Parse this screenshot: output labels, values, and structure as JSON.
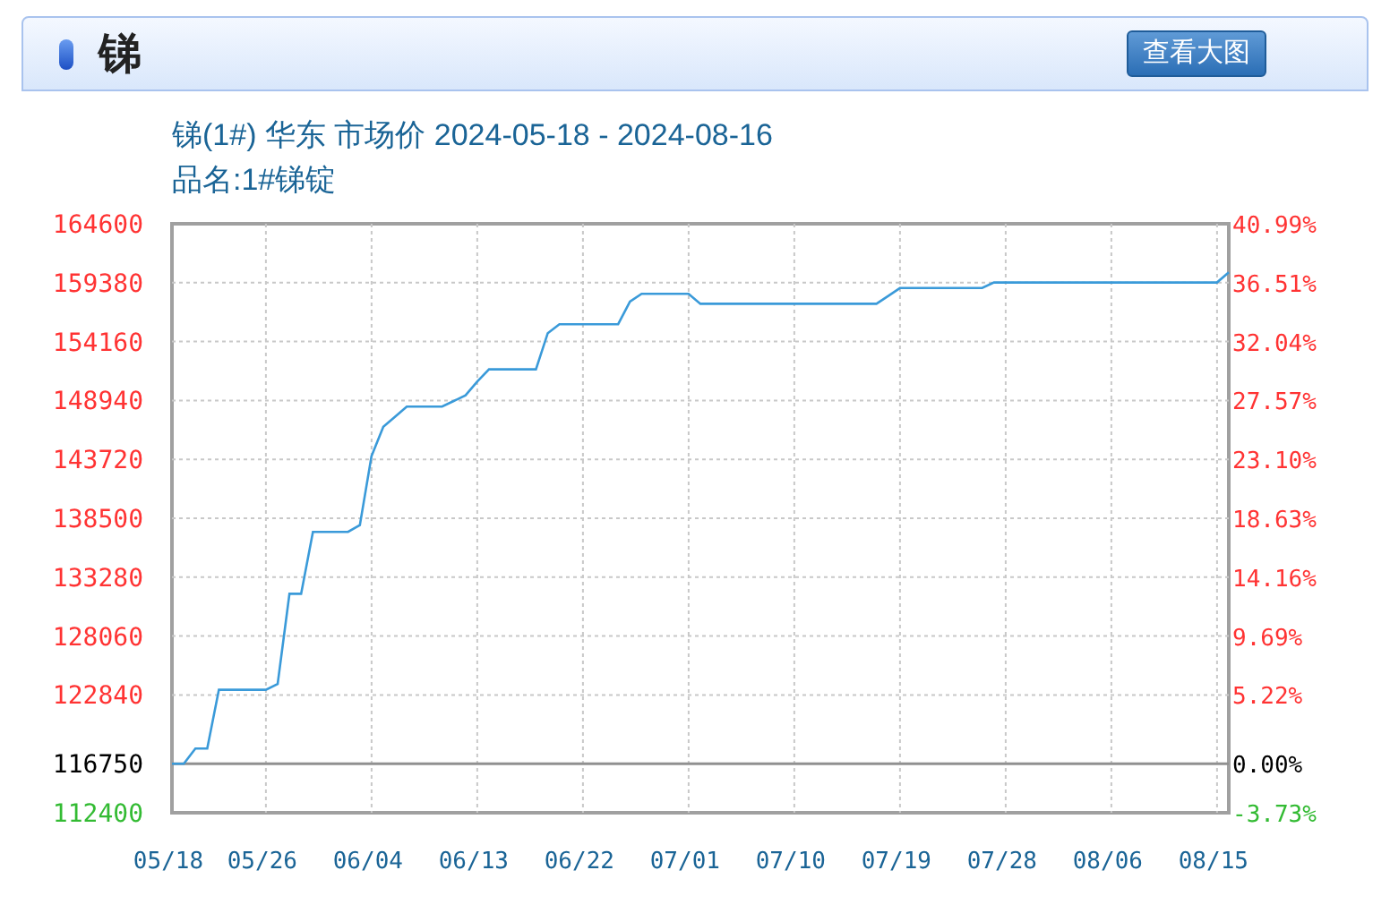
{
  "header": {
    "title": "锑",
    "button": "查看大图"
  },
  "subtitle": "锑(1#) 华东 市场价 2024-05-18 - 2024-08-16",
  "product": "品名:1#锑锭",
  "chart": {
    "chart_data": {
      "type": "line",
      "categories": [
        "05/18",
        null,
        null,
        null,
        null,
        null,
        null,
        null,
        "05/26",
        null,
        null,
        null,
        null,
        null,
        null,
        null,
        null,
        "06/04",
        null,
        null,
        null,
        null,
        null,
        null,
        null,
        null,
        "06/13",
        null,
        null,
        null,
        null,
        null,
        null,
        null,
        null,
        "06/22",
        null,
        null,
        null,
        null,
        null,
        null,
        null,
        null,
        "07/01",
        null,
        null,
        null,
        null,
        null,
        null,
        null,
        null,
        "07/10",
        null,
        null,
        null,
        null,
        null,
        null,
        null,
        null,
        "07/19",
        null,
        null,
        null,
        null,
        null,
        null,
        null,
        null,
        "07/28",
        null,
        null,
        null,
        null,
        null,
        null,
        null,
        null,
        "08/06",
        null,
        null,
        null,
        null,
        null,
        null,
        null,
        null,
        "08/15",
        null
      ],
      "series": [
        {
          "color": "#3a9ad9",
          "values": [
            116750,
            116750,
            118100,
            118100,
            123300,
            123300,
            123300,
            123300,
            123300,
            123800,
            131800,
            131800,
            137300,
            137300,
            137300,
            137300,
            137900,
            144000,
            146600,
            147500,
            148400,
            148400,
            148400,
            148400,
            148900,
            149400,
            150600,
            151700,
            151700,
            151700,
            151700,
            151700,
            154900,
            155700,
            155700,
            155700,
            155700,
            155700,
            155700,
            157700,
            158400,
            158400,
            158400,
            158400,
            158400,
            157500,
            157500,
            157500,
            157500,
            157500,
            157500,
            157500,
            157500,
            157500,
            157500,
            157500,
            157500,
            157500,
            157500,
            157500,
            157500,
            158200,
            158900,
            158900,
            158900,
            158900,
            158900,
            158900,
            158900,
            158900,
            159400,
            159400,
            159400,
            159400,
            159400,
            159400,
            159400,
            159400,
            159400,
            159400,
            159400,
            159400,
            159400,
            159400,
            159400,
            159400,
            159400,
            159400,
            159400,
            159400,
            160300
          ]
        }
      ],
      "ylim": [
        112400,
        164600
      ],
      "yticks": [
        {
          "value": 164600,
          "label": "164600"
        },
        {
          "value": 159380,
          "label": "159380"
        },
        {
          "value": 154160,
          "label": "154160"
        },
        {
          "value": 148940,
          "label": "148940"
        },
        {
          "value": 143720,
          "label": "143720"
        },
        {
          "value": 138500,
          "label": "138500"
        },
        {
          "value": 133280,
          "label": "133280"
        },
        {
          "value": 128060,
          "label": "128060"
        },
        {
          "value": 122840,
          "label": "122840"
        },
        {
          "value": 116750,
          "label": "116750"
        },
        {
          "value": 112400,
          "label": "112400"
        }
      ],
      "y2lim": [
        -3.73,
        40.99
      ],
      "y2ticks": [
        {
          "value": 40.99,
          "label": "40.99%"
        },
        {
          "value": 36.51,
          "label": "36.51%"
        },
        {
          "value": 32.04,
          "label": "32.04%"
        },
        {
          "value": 27.57,
          "label": "27.57%"
        },
        {
          "value": 23.1,
          "label": "23.10%"
        },
        {
          "value": 18.63,
          "label": "18.63%"
        },
        {
          "value": 14.16,
          "label": "14.16%"
        },
        {
          "value": 9.69,
          "label": "9.69%"
        },
        {
          "value": 5.22,
          "label": "5.22%"
        },
        {
          "value": 0,
          "label": "0.00%"
        },
        {
          "value": -3.73,
          "label": "-3.73%"
        }
      ],
      "grid": true
    }
  }
}
